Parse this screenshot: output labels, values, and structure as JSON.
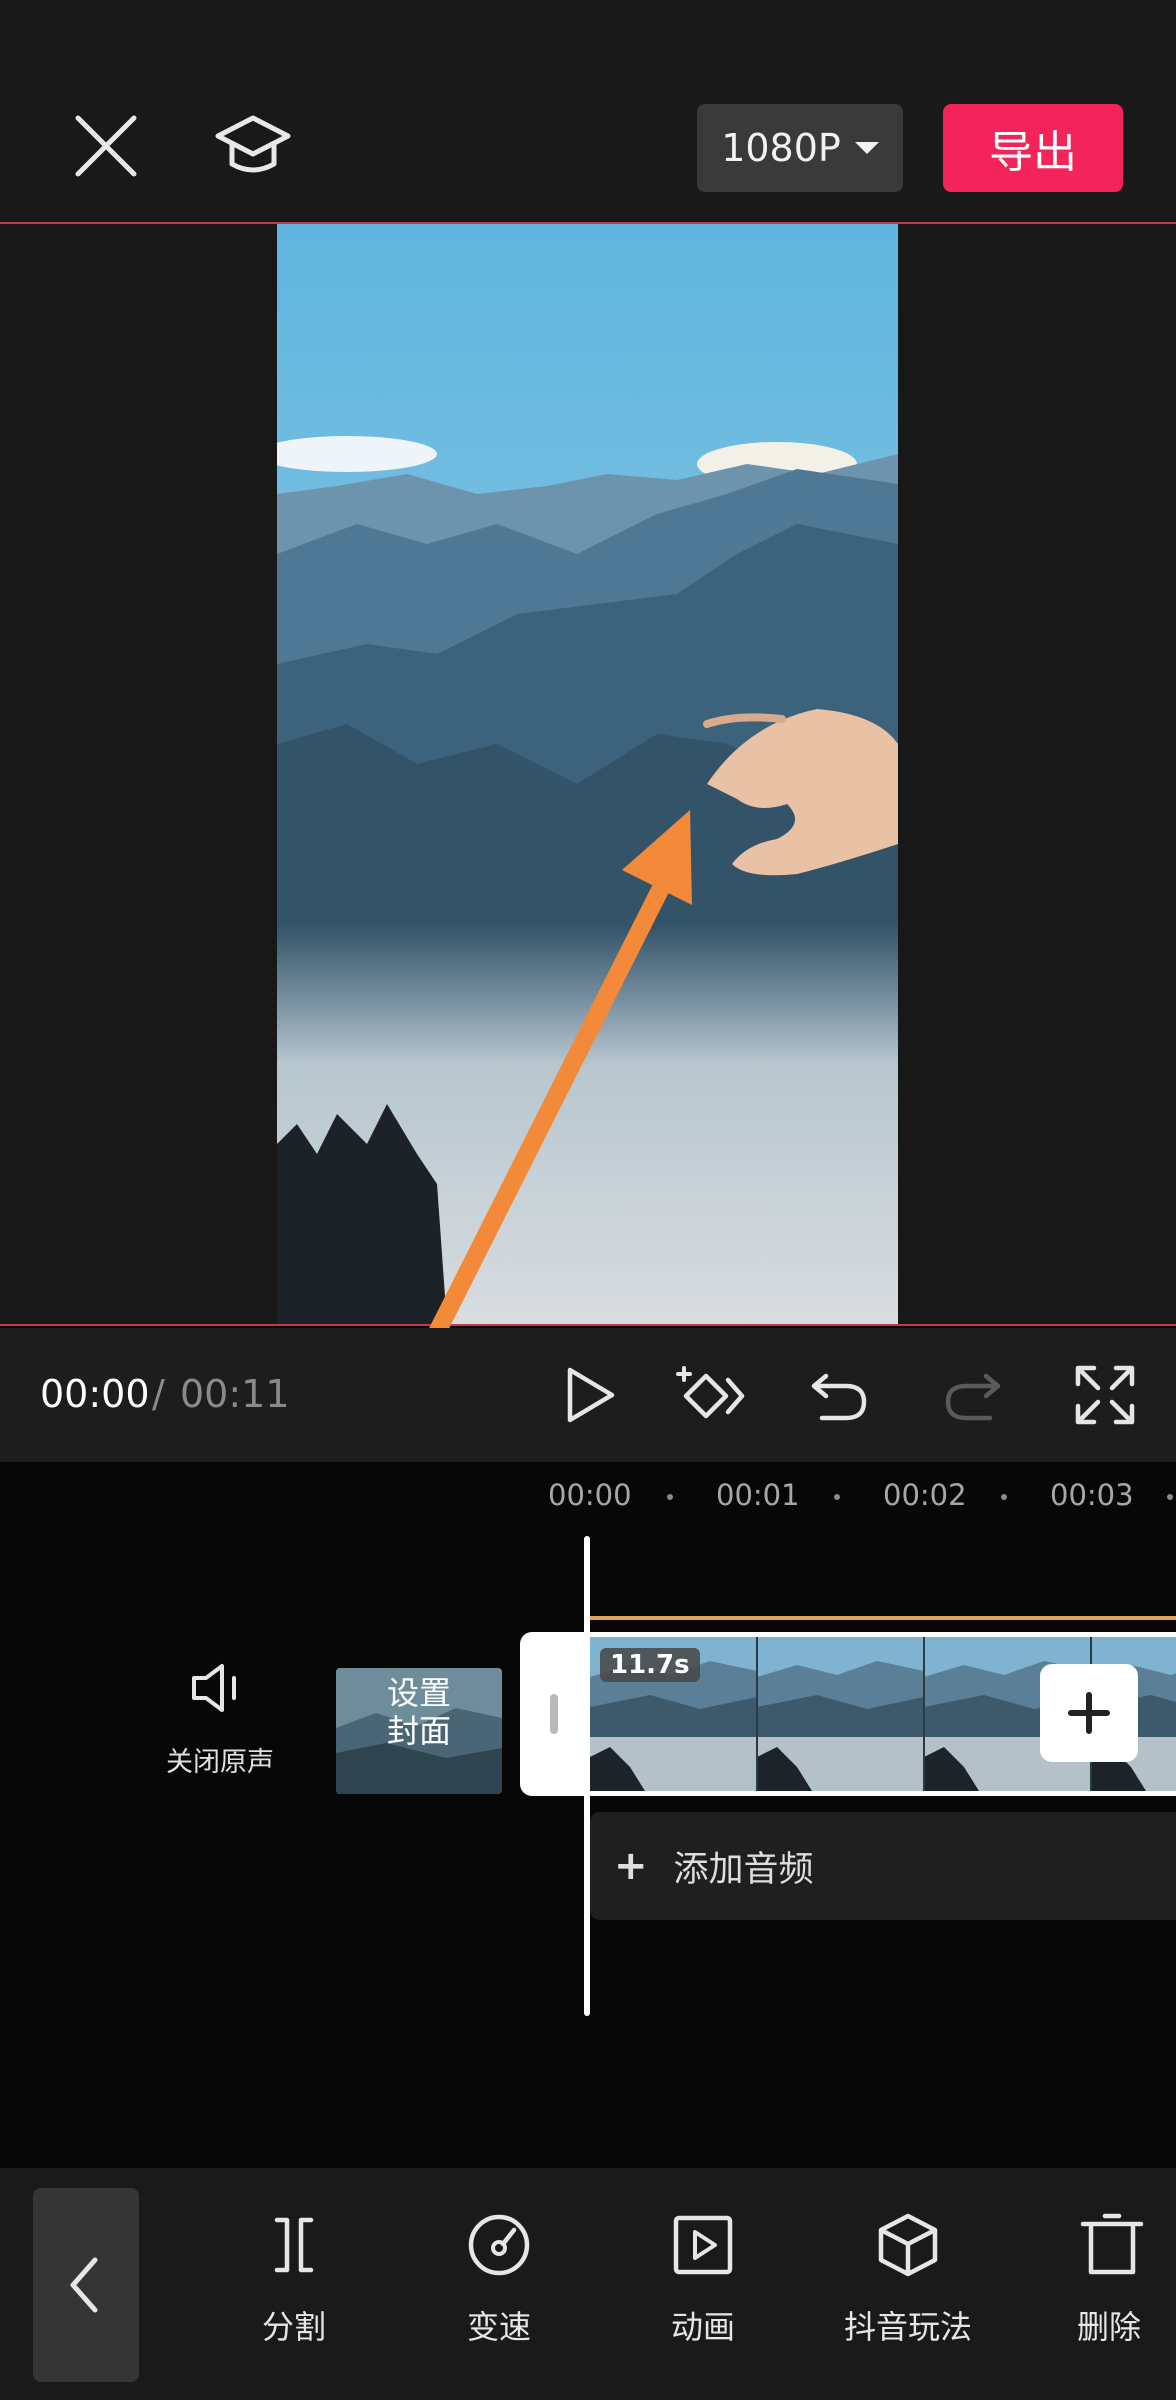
{
  "header": {
    "resolution_label": "1080P",
    "export_label": "导出"
  },
  "playback": {
    "current_time": "00:00",
    "separator": "/",
    "total_time": "00:11"
  },
  "timeline": {
    "ticks": [
      "00:00",
      "00:01",
      "00:02",
      "00:03"
    ],
    "mute_label": "关闭原声",
    "cover_label_line1": "设置",
    "cover_label_line2": "封面",
    "clip_duration": "11.7s",
    "add_audio_label": "添加音频"
  },
  "toolbar": {
    "items": [
      {
        "label": "分割",
        "icon": "split-icon"
      },
      {
        "label": "变速",
        "icon": "speed-icon"
      },
      {
        "label": "动画",
        "icon": "animation-icon"
      },
      {
        "label": "抖音玩法",
        "icon": "cube-icon"
      },
      {
        "label": "删除",
        "icon": "delete-icon"
      }
    ]
  },
  "colors": {
    "export_button": "#f2245a",
    "preview_border": "#c23a4e",
    "annotation_arrow": "#f28a3a",
    "clip_top_line": "#e0a35c"
  }
}
